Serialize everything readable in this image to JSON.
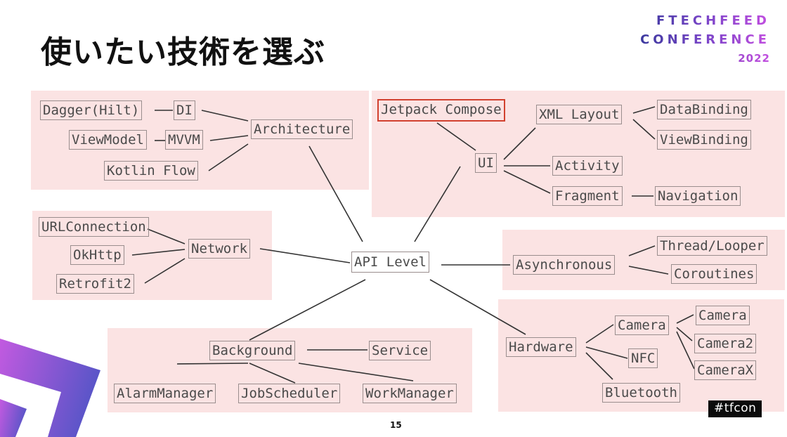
{
  "slide": {
    "title": "使いたい技術を選ぶ",
    "page_number": "15",
    "hashtag": "#tfcon"
  },
  "logo": {
    "line1": "FTECHFEED",
    "line2": "CONFERENCE",
    "line3": "2022"
  },
  "colors": {
    "region_fill": "#fbe3e3",
    "node_border": "#9a8e8e",
    "highlight_border": "#d2412f",
    "logo_start": "#3c3a9e",
    "logo_end": "#c24ee0"
  },
  "diagram": {
    "center": "API Level",
    "groups": {
      "architecture": {
        "root": "Architecture",
        "di": "DI",
        "dagger": "Dagger(Hilt)",
        "mvvm": "MVVM",
        "viewmodel": "ViewModel",
        "kotlin_flow": "Kotlin Flow"
      },
      "ui": {
        "root": "UI",
        "jetpack_compose": "Jetpack Compose",
        "xml_layout": "XML Layout",
        "databinding": "DataBinding",
        "viewbinding": "ViewBinding",
        "activity": "Activity",
        "fragment": "Fragment",
        "navigation": "Navigation"
      },
      "network": {
        "root": "Network",
        "urlconnection": "URLConnection",
        "okhttp": "OkHttp",
        "retrofit2": "Retrofit2"
      },
      "asynchronous": {
        "root": "Asynchronous",
        "thread_looper": "Thread/Looper",
        "coroutines": "Coroutines"
      },
      "background": {
        "root": "Background",
        "service": "Service",
        "alarmmanager": "AlarmManager",
        "jobscheduler": "JobScheduler",
        "workmanager": "WorkManager"
      },
      "hardware": {
        "root": "Hardware",
        "camera": "Camera",
        "camera1": "Camera",
        "camera2": "Camera2",
        "camerax": "CameraX",
        "nfc": "NFC",
        "bluetooth": "Bluetooth"
      }
    },
    "highlighted": "Jetpack Compose"
  }
}
